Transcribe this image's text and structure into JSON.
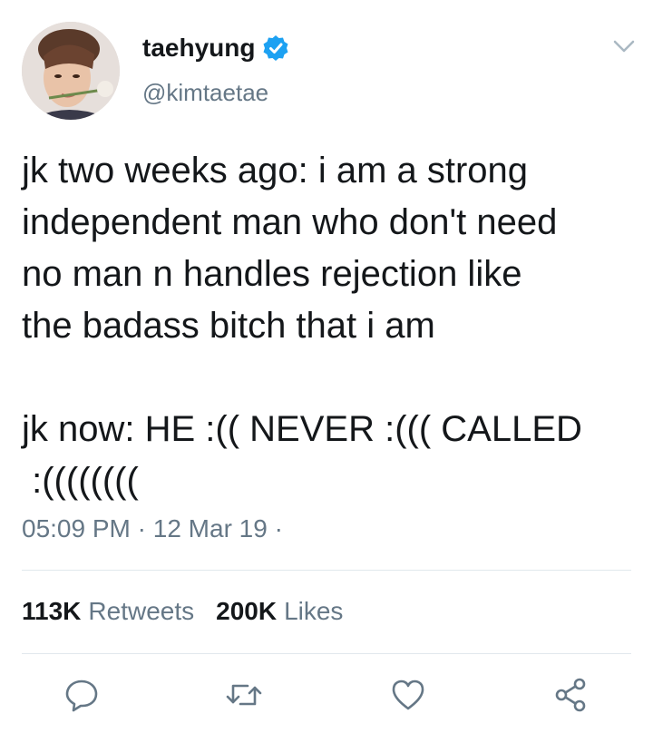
{
  "user": {
    "display_name": "taehyung",
    "handle": "@kimtaetae",
    "verified": true
  },
  "tweet": {
    "text": "jk two weeks ago: i am a strong\nindependent man who don't need\nno man n handles rejection like\nthe badass bitch that i am\n\njk now: HE :(( NEVER :((( CALLED\n :((((((((",
    "time": "05:09 PM",
    "date": "12 Mar 19",
    "separator": "·"
  },
  "stats": {
    "retweets_count": "113K",
    "retweets_label": "Retweets",
    "likes_count": "200K",
    "likes_label": "Likes"
  },
  "colors": {
    "text": "#14171a",
    "secondary": "#657786",
    "verified_blue": "#1da1f2",
    "divider": "#e1e8ed"
  },
  "icons": {
    "caret": "chevron-down-icon",
    "reply": "reply-icon",
    "retweet": "retweet-icon",
    "like": "heart-icon",
    "share": "share-icon",
    "verified": "verified-badge-icon"
  }
}
